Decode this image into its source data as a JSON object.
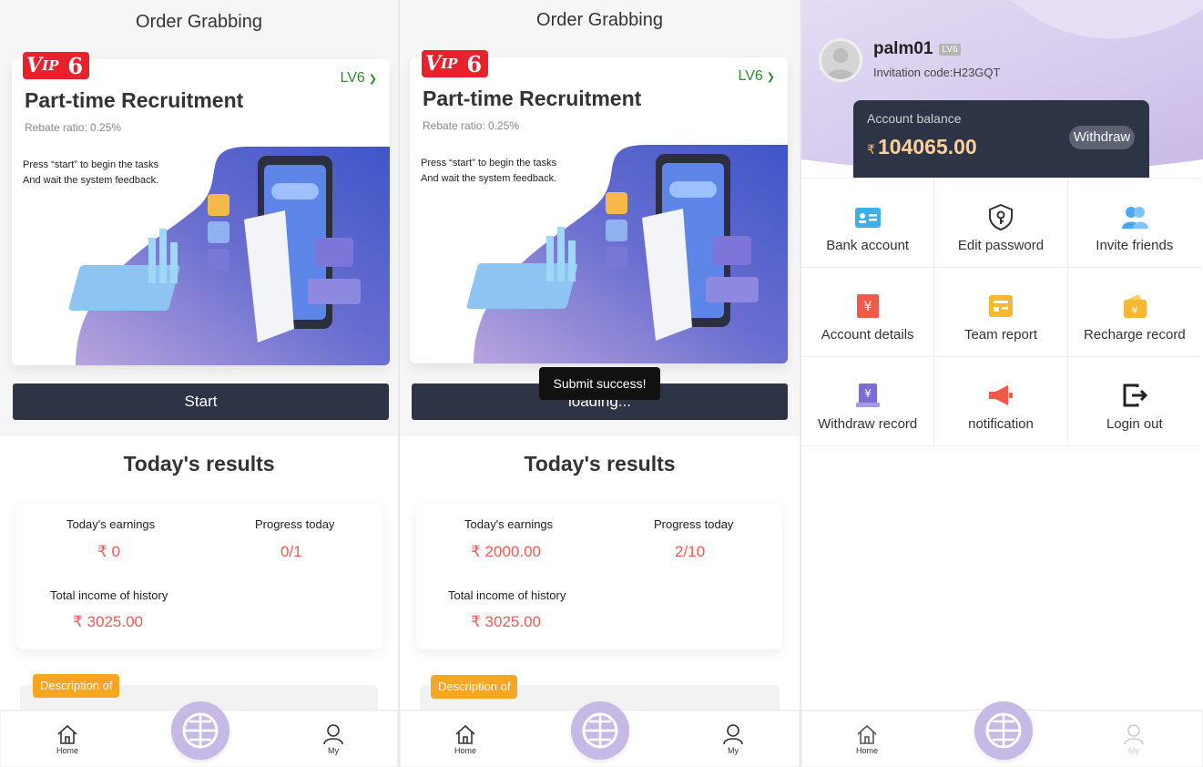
{
  "order_title": "Order Grabbing",
  "vip": {
    "prefix": "V",
    "mid": "IP",
    "level": "6"
  },
  "card": {
    "level": "LV6",
    "title": "Part-time Recruitment",
    "rebate": "Rebate ratio: 0.25%",
    "illustration_line1": "Press “start” to begin the tasks",
    "illustration_line2": "And wait the system feedback."
  },
  "panel1": {
    "button_label": "Start",
    "today_earnings": "₹ 0",
    "progress": "0/1",
    "total_income": "₹ 3025.00"
  },
  "panel2": {
    "button_label": "loading...",
    "toast": "Submit success!",
    "today_earnings": "₹ 2000.00",
    "progress": "2/10",
    "total_income": "₹ 3025.00"
  },
  "results": {
    "title": "Today's results",
    "earnings_label": "Today's earnings",
    "progress_label": "Progress today",
    "total_label": "Total income of history",
    "description_badge": "Description of"
  },
  "tabbar": {
    "home": "Home",
    "my": "My"
  },
  "profile": {
    "username": "palm01",
    "level_tag": "LV6",
    "invitation": "Invitation code:H23GQT",
    "balance_label": "Account balance",
    "currency": "₹",
    "balance": "104065.00",
    "withdraw_label": "Withdraw",
    "menu": [
      {
        "label": "Bank account",
        "icon": "bank-card-icon",
        "color": "#3cb0e8"
      },
      {
        "label": "Edit password",
        "icon": "shield-key-icon",
        "color": "#333333"
      },
      {
        "label": "Invite friends",
        "icon": "people-icon",
        "color": "#4aa8f0"
      },
      {
        "label": "Account details",
        "icon": "ledger-icon",
        "color": "#f05a4a"
      },
      {
        "label": "Team report",
        "icon": "report-icon",
        "color": "#f7b733"
      },
      {
        "label": "Recharge record",
        "icon": "wallet-icon",
        "color": "#f7b733"
      },
      {
        "label": "Withdraw record",
        "icon": "withdraw-icon",
        "color": "#7b6cd6"
      },
      {
        "label": "notification",
        "icon": "megaphone-icon",
        "color": "#f05a4a"
      },
      {
        "label": "Login out",
        "icon": "logout-icon",
        "color": "#222222"
      }
    ]
  }
}
